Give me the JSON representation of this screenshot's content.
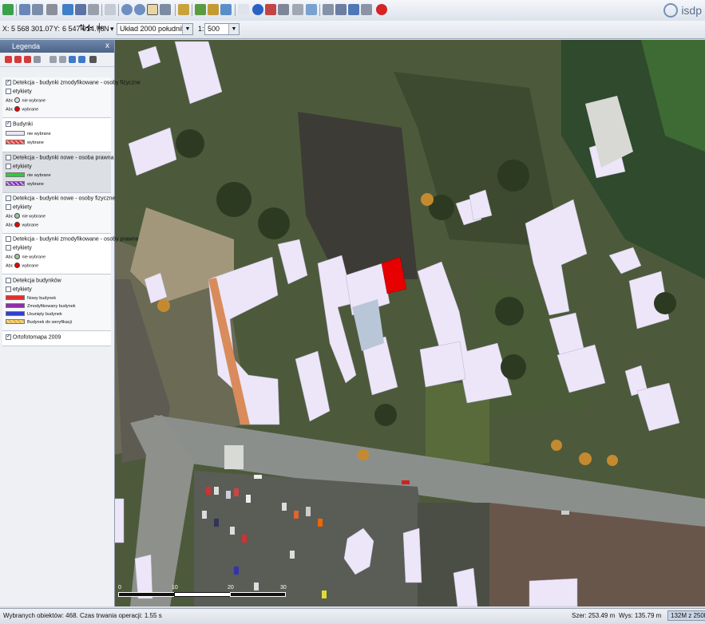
{
  "toolbar": {
    "brand": "isdp"
  },
  "coords": {
    "x_label": "X:",
    "x_value": "5 568 301.07",
    "y_label": "Y:",
    "y_value": "6 547 014.78",
    "north": "N",
    "crs": "Układ 2000 południk 18",
    "scale_label": "1:",
    "scale_value": "500"
  },
  "legend": {
    "title": "Legenda",
    "close": "x",
    "groups": [
      {
        "title": "Detekcja - budynki zmodyfikowane - osoby fizyczne",
        "checked": true,
        "etykiety": "etykiety",
        "items": [
          "nie wybrane",
          "wybrane"
        ]
      },
      {
        "title": "Budynki",
        "checked": true,
        "items": [
          "nie wybrane",
          "wybrane"
        ]
      },
      {
        "title": "Detekcja - budynki nowe - osoba prawna",
        "checked": false,
        "etykiety": "etykiety",
        "items": [
          "nie wybrane",
          "wybrane"
        ]
      },
      {
        "title": "Detekcja - budynki nowe - osoby fizyczne",
        "checked": false,
        "etykiety": "etykiety",
        "items": [
          "nie wybrane",
          "wybrane"
        ]
      },
      {
        "title": "Detekcja - budynki zmodyfikowane - osoby prawne",
        "checked": false,
        "etykiety": "etykiety",
        "items": [
          "nie wybrane",
          "wybrane"
        ]
      },
      {
        "title": "Detekcja budynków",
        "checked": false,
        "etykiety": "etykiety",
        "items": [
          "Nowy budynek",
          "Zmodyfikowany budynek",
          "Usunięty budynek",
          "Budynek do weryfikacji"
        ]
      },
      {
        "title": "Ortofotomapa 2009",
        "checked": true
      }
    ],
    "abc": "Abc"
  },
  "scalebar": {
    "labels": [
      "0",
      "10",
      "20",
      "30"
    ]
  },
  "status": {
    "left": "Wybranych obiektów: 468. Czas trwania operacji: 1.55 s",
    "width": "Szer: 253.49 m",
    "height": "Wys: 135.79 m",
    "memory": "132M z 250M"
  },
  "colors": {
    "building_fill": "#ece6f8",
    "selected": "#e60000",
    "road": "#8b8f8c"
  }
}
